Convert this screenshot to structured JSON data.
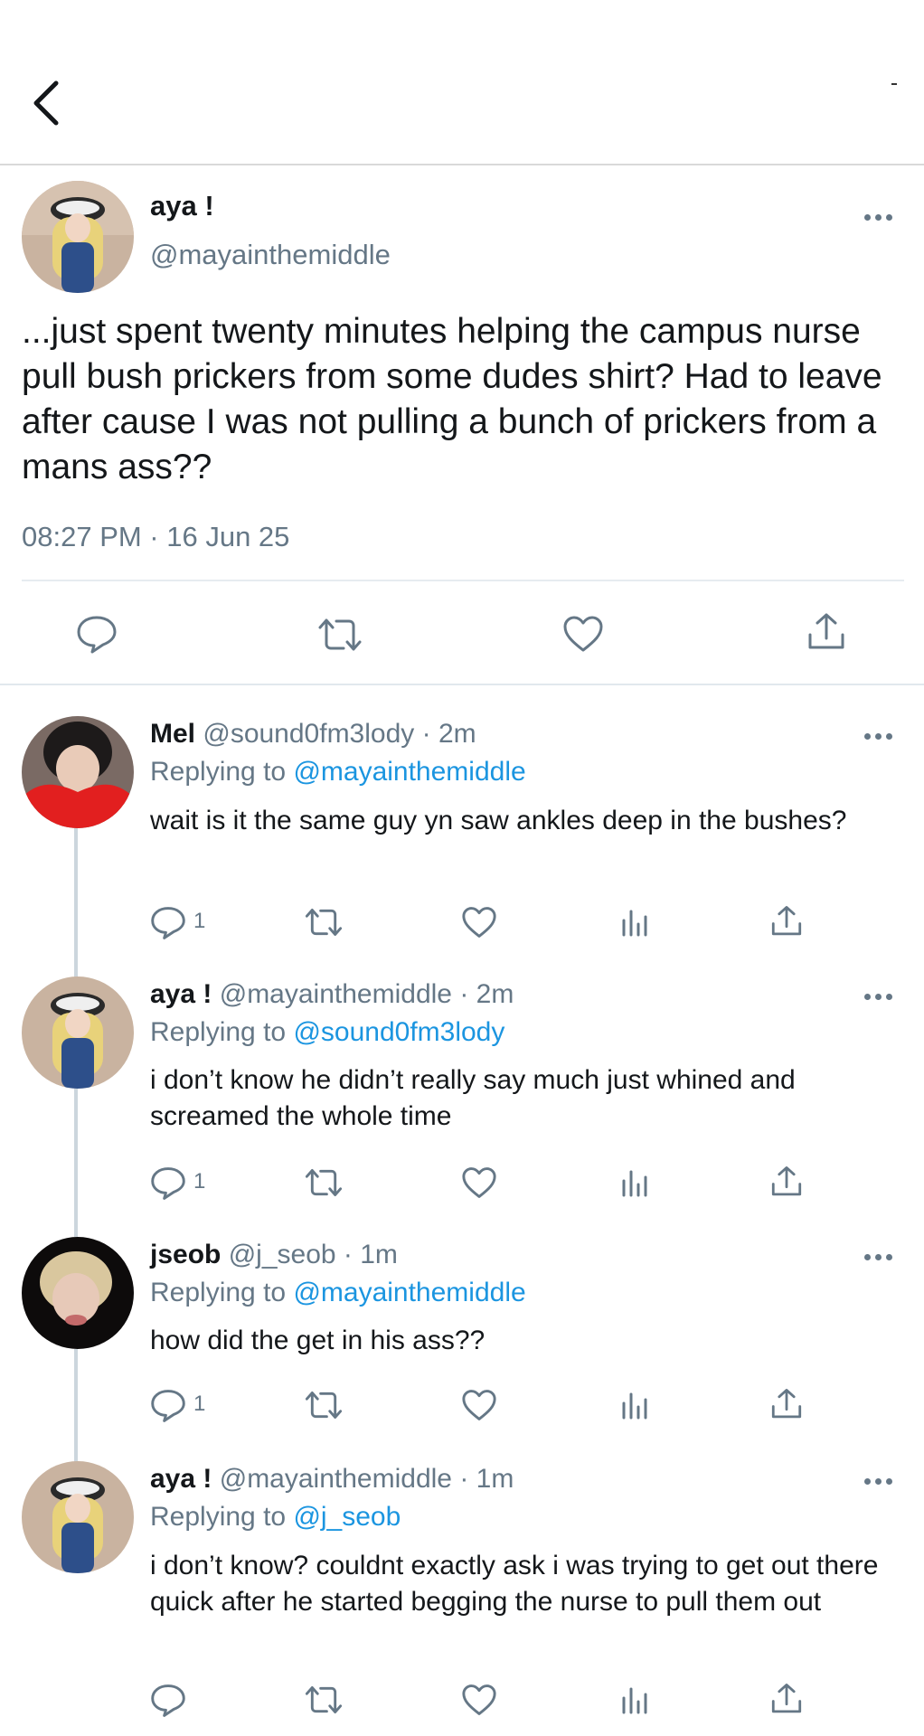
{
  "nav": {
    "back_icon": "chevron-left-icon"
  },
  "main_tweet": {
    "display_name": "aya !",
    "handle": "@mayainthemiddle",
    "text": "...just spent twenty minutes helping the campus nurse pull bush prickers from some dudes shirt? Had to leave after cause I was not pulling a bunch of prickers from a mans ass??",
    "timestamp": "08:27 PM · 16 Jun 25",
    "actions": [
      "reply-icon",
      "retweet-icon",
      "like-icon",
      "share-icon"
    ]
  },
  "replies": [
    {
      "display_name": "Mel",
      "handle": "@sound0fm3lody",
      "time": "· 2m",
      "replying_prefix": "Replying to",
      "replying_to": "@mayainthemiddle",
      "text": "wait is it the same guy yn saw ankles deep in the bushes?",
      "reply_count": "1"
    },
    {
      "display_name": "aya !",
      "handle": "@mayainthemiddle",
      "time": "· 2m",
      "replying_prefix": "Replying to",
      "replying_to": "@sound0fm3lody",
      "text": "i don’t know he didn’t really say much just whined and screamed the whole time",
      "reply_count": "1"
    },
    {
      "display_name": "jseob",
      "handle": "@j_seob",
      "time": "· 1m",
      "replying_prefix": "Replying to",
      "replying_to": "@mayainthemiddle",
      "text": "how did the get in his ass??",
      "reply_count": "1"
    },
    {
      "display_name": "aya !",
      "handle": "@mayainthemiddle",
      "time": "· 1m",
      "replying_prefix": "Replying to",
      "replying_to": "@j_seob",
      "text": "i don’t know? couldnt exactly ask i was trying to get out there quick after he started  begging the nurse to pull them out",
      "reply_count": ""
    }
  ],
  "colors": {
    "text": "#14171a",
    "secondary": "#657786",
    "link": "#1b95e0",
    "divider": "#e1e8ed"
  }
}
